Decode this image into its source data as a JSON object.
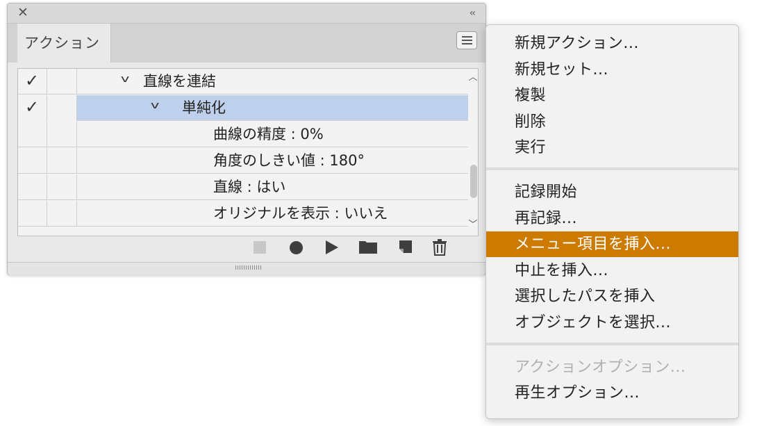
{
  "panel": {
    "close_glyph": "✕",
    "collapse_glyph": "‹‹",
    "tab_label": "アクション",
    "menu_button_icon": "hamburger-menu-icon",
    "rows": [
      {
        "checked": true,
        "label": "直線を連結",
        "expanded": true,
        "level": 1,
        "selected": false
      },
      {
        "checked": true,
        "label": "単純化",
        "expanded": true,
        "level": 2,
        "selected": true
      },
      {
        "checked": false,
        "label": "曲線の精度 : 0%",
        "expanded": false,
        "level": 3,
        "selected": false
      },
      {
        "checked": false,
        "label": "角度のしきい値 : 180°",
        "expanded": false,
        "level": 3,
        "selected": false
      },
      {
        "checked": false,
        "label": "直線 : はい",
        "expanded": false,
        "level": 3,
        "selected": false
      },
      {
        "checked": false,
        "label": "オリジナルを表示 : いいえ",
        "expanded": false,
        "level": 3,
        "selected": false
      }
    ],
    "toolbar_icons": [
      "stop-icon",
      "record-icon",
      "play-icon",
      "new-set-folder-icon",
      "new-action-icon",
      "trash-icon"
    ]
  },
  "menu": {
    "groups": [
      [
        "新規アクション...",
        "新規セット...",
        "複製",
        "削除",
        "実行"
      ],
      [
        "記録開始",
        "再記録...",
        "メニュー項目を挿入...",
        "中止を挿入...",
        "選択したパスを挿入",
        "オブジェクトを選択..."
      ],
      [
        "アクションオプション...",
        "再生オプション..."
      ]
    ],
    "highlighted": "メニュー項目を挿入...",
    "disabled": [
      "アクションオプション..."
    ],
    "highlight_color": "#cc7a00",
    "selection_color": "#bfd0ec"
  }
}
